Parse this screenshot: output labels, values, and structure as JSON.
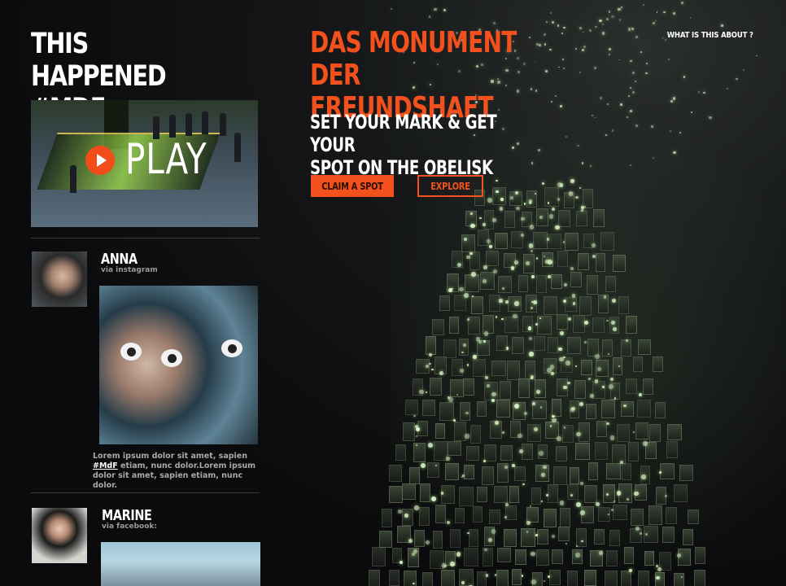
{
  "left": {
    "title_line1": "THIS HAPPENED",
    "title_line2": "#MDF",
    "video": {
      "play_label": "PLAY"
    }
  },
  "posts": [
    {
      "name": "ANNA",
      "via": "via instagram",
      "text": "Lorem ipsum  dolor sit amet, sapien ",
      "tag": "#MdF",
      "text_after": " etiam, nunc dolor.Lorem ipsum  dolor sit amet, sapien etiam, nunc dolor."
    },
    {
      "name": "MARINE",
      "via": "via facebook:"
    }
  ],
  "hero": {
    "title_line1": "DAS MONUMENT DER",
    "title_line2": "FREUNDSHAFT",
    "subtitle_line1": "SET YOUR MARK & GET YOUR",
    "subtitle_line2": "SPOT ON THE OBELISK",
    "claim_label": "CLAIM A SPOT",
    "explore_label": "EXPLORE"
  },
  "nav": {
    "about_label": "WHAT IS THIS ABOUT ?"
  },
  "colors": {
    "accent": "#f2501c",
    "background": "#0a0a0c"
  }
}
